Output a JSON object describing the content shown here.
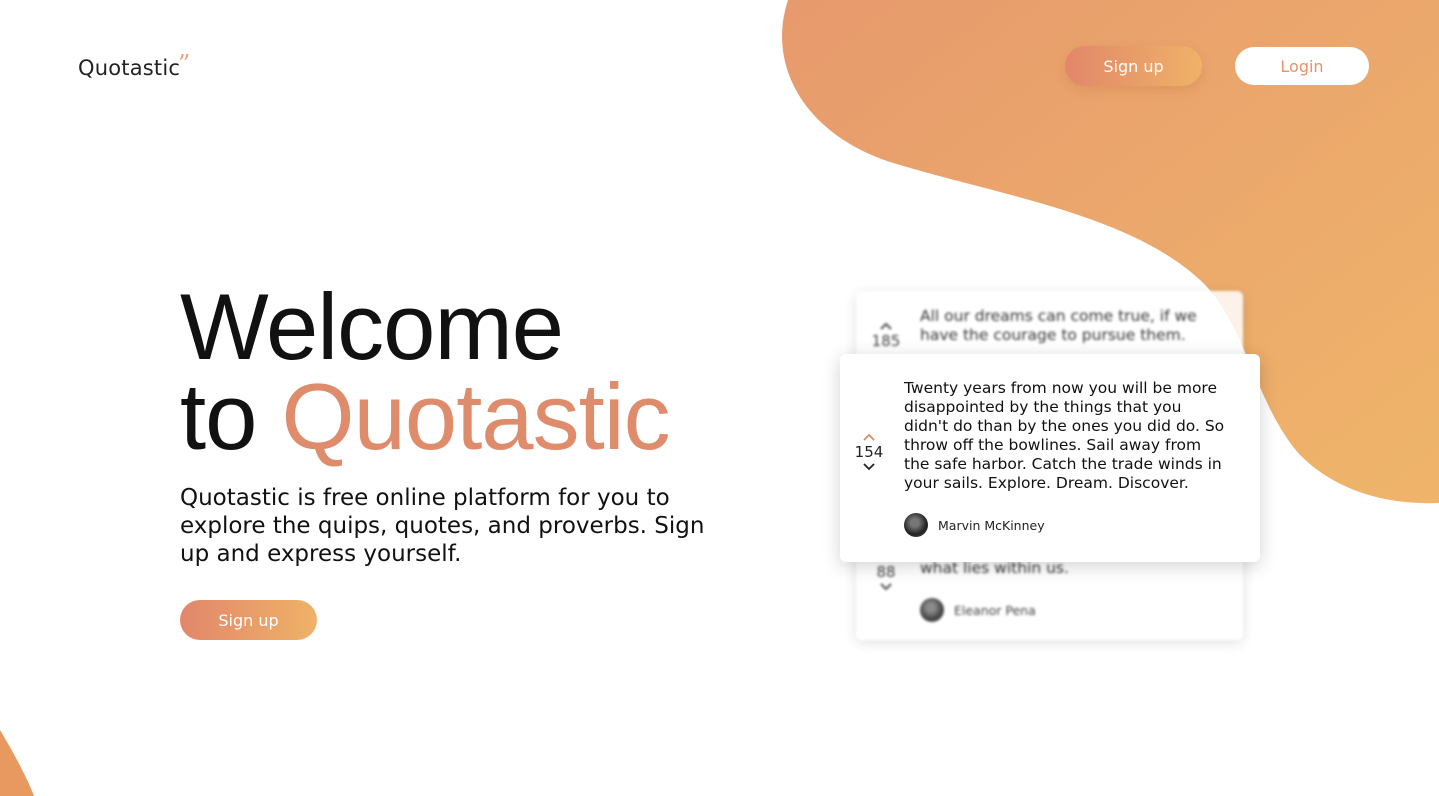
{
  "brand": {
    "name": "Quotastic",
    "mark": "”"
  },
  "nav": {
    "signup_label": "Sign up",
    "login_label": "Login"
  },
  "hero": {
    "title_line1": "Welcome",
    "title_line2_prefix": "to ",
    "title_line2_accent": "Quotastic",
    "description": "Quotastic is free online platform for you to explore the  quips, quotes, and proverbs. Sign up and express yourself.",
    "cta_label": "Sign up"
  },
  "quotes": [
    {
      "text": "All our dreams can come true, if we have the courage to pursue them.",
      "votes": "185",
      "author": ""
    },
    {
      "text": "Twenty years from now you will be more disappointed by the things that you didn't do than by the ones you did do. So throw off the bowlines. Sail away from the safe harbor. Catch the trade winds in your sails. Explore. Dream. Discover.",
      "votes": "154",
      "author": "Marvin McKinney"
    },
    {
      "text": "what lies within us.",
      "votes": "88",
      "author": "Eleanor Pena"
    }
  ],
  "colors": {
    "accent": "#de8c6c",
    "gradient_start": "#e2876a",
    "gradient_end": "#efb268",
    "blob": "#e9a268"
  }
}
